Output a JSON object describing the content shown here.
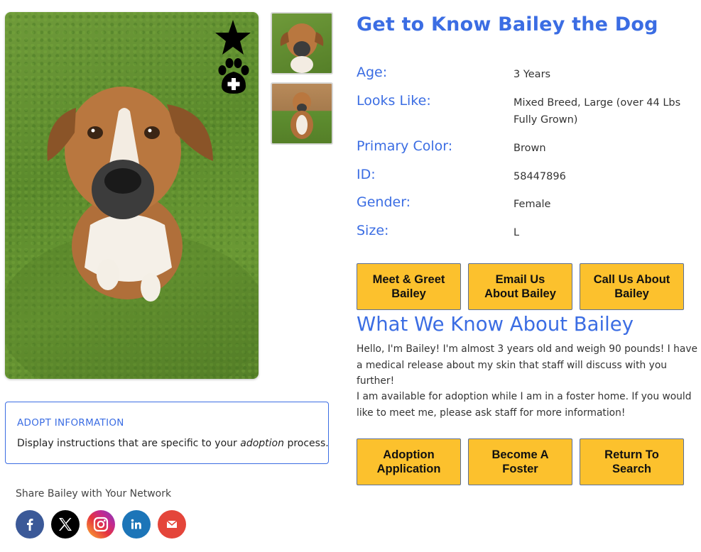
{
  "pet": {
    "title": "Get to Know Bailey the Dog",
    "details": [
      {
        "label": "Age:",
        "value": "3 Years"
      },
      {
        "label": "Looks Like:",
        "value": "Mixed Breed, Large (over 44 Lbs Fully Grown)"
      },
      {
        "label": "Primary Color:",
        "value": "Brown"
      },
      {
        "label": "ID:",
        "value": "58447896"
      },
      {
        "label": "Gender:",
        "value": "Female"
      },
      {
        "label": "Size:",
        "value": "L"
      }
    ]
  },
  "action_buttons": [
    {
      "label": "Meet & Greet Bailey"
    },
    {
      "label": "Email Us About Bailey"
    },
    {
      "label": "Call Us About Bailey"
    }
  ],
  "about": {
    "title": "What We Know About Bailey",
    "paragraph_1": "Hello, I'm Bailey! I'm almost 3 years old and weigh 90 pounds! I have a medical release about my skin that staff will discuss with you further!",
    "paragraph_2": "I am available for adoption while I am in a foster home. If you would like to meet me, please ask staff for more information!"
  },
  "bottom_buttons": [
    {
      "label": "Adoption Application"
    },
    {
      "label": "Become A Foster"
    },
    {
      "label": "Return To Search"
    }
  ],
  "adopt_info": {
    "title": "ADOPT INFORMATION",
    "text_before": "Display instructions that are specific to your ",
    "text_emphasis": "adoption",
    "text_after": " process."
  },
  "share": {
    "label": "Share Bailey with Your Network",
    "networks": [
      {
        "icon": "facebook-icon",
        "color": "#3b5998"
      },
      {
        "icon": "x-icon",
        "color": "#000000"
      },
      {
        "icon": "instagram-icon",
        "color": "#d6249f"
      },
      {
        "icon": "linkedin-icon",
        "color": "#1c75b8"
      },
      {
        "icon": "email-icon",
        "color": "#e4453a"
      }
    ]
  },
  "colors": {
    "accent": "#3b6de3",
    "button": "#fcc12d"
  }
}
